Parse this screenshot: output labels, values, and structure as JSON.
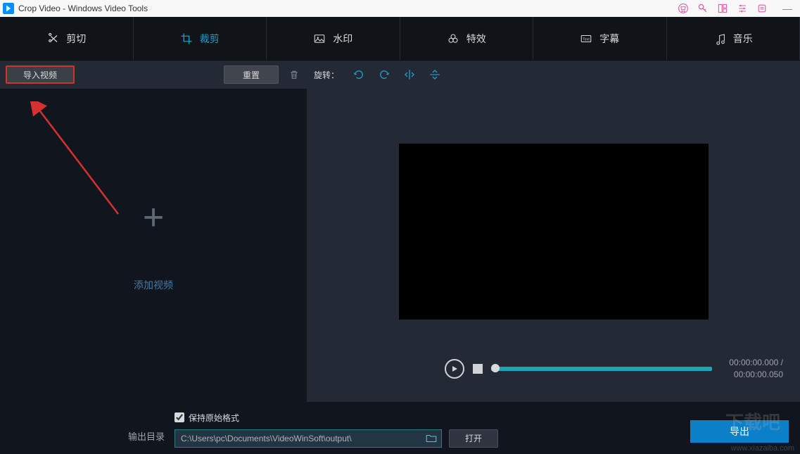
{
  "title_bar": {
    "title": "Crop Video - Windows Video Tools"
  },
  "tabs": {
    "cut": "剪切",
    "crop": "裁剪",
    "watermark": "水印",
    "effect": "特效",
    "subtitle": "字幕",
    "music": "音乐"
  },
  "toolbar": {
    "import": "导入视频",
    "reset": "重置",
    "rotate_label": "旋转："
  },
  "left_panel": {
    "add_video": "添加视频"
  },
  "player": {
    "time_current": "00:00:00.000 /",
    "time_total": "00:00:00.050"
  },
  "bottom": {
    "output_label": "输出目录",
    "keep_format": "保持原始格式",
    "path": "C:\\Users\\pc\\Documents\\VideoWinSoft\\output\\",
    "open": "打开",
    "export": "导出"
  },
  "watermark": {
    "logo": "下载吧",
    "url": "www.xiazaiba.com"
  }
}
